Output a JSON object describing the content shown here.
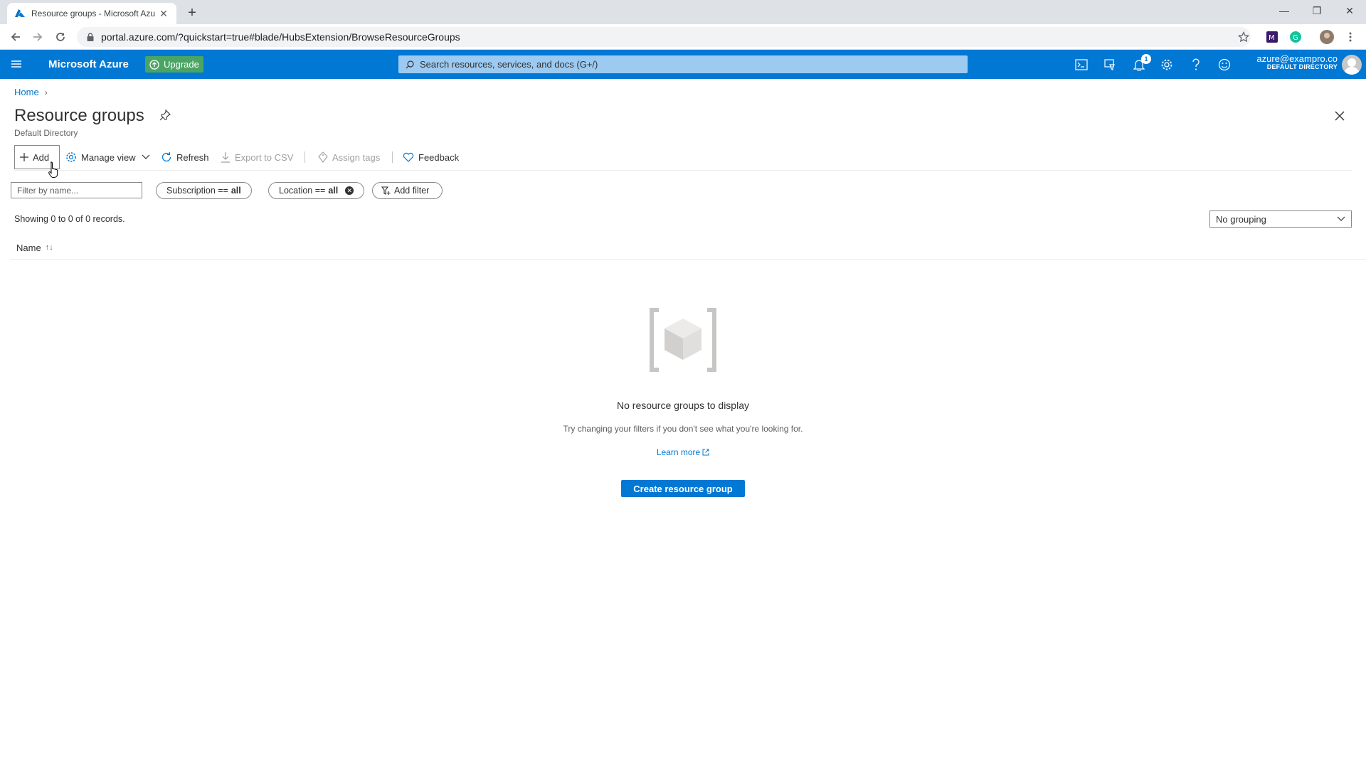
{
  "browser": {
    "tab_title": "Resource groups - Microsoft Azu",
    "url": "portal.azure.com/?quickstart=true#blade/HubsExtension/BrowseResourceGroups"
  },
  "header": {
    "brand": "Microsoft Azure",
    "upgrade_label": "Upgrade",
    "search_placeholder": "Search resources, services, and docs (G+/)",
    "notification_count": "1",
    "account_email": "azure@exampro.co",
    "account_directory": "DEFAULT DIRECTORY"
  },
  "breadcrumb": {
    "home": "Home"
  },
  "page": {
    "title": "Resource groups",
    "subtitle": "Default Directory"
  },
  "toolbar": {
    "add": "Add",
    "manage_view": "Manage view",
    "refresh": "Refresh",
    "export_csv": "Export to CSV",
    "assign_tags": "Assign tags",
    "feedback": "Feedback"
  },
  "filters": {
    "name_placeholder": "Filter by name...",
    "subscription_label": "Subscription ==",
    "subscription_value": "all",
    "location_label": "Location ==",
    "location_value": "all",
    "add_filter": "Add filter"
  },
  "list": {
    "records_text": "Showing 0 to 0 of 0 records.",
    "grouping_value": "No grouping",
    "column_name": "Name"
  },
  "empty": {
    "title": "No resource groups to display",
    "subtitle": "Try changing your filters if you don't see what you're looking for.",
    "learn_more": "Learn more",
    "create_button": "Create resource group"
  },
  "colors": {
    "azure_blue": "#0078d4",
    "upgrade_green": "#4aa564",
    "search_bg": "#9ccaf1"
  }
}
